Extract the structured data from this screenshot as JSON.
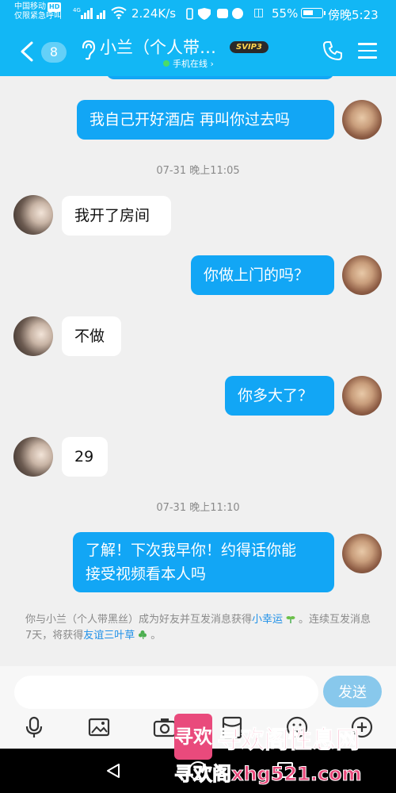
{
  "status_bar": {
    "carrier_line1": "中国移动",
    "carrier_badge": "HD",
    "carrier_line2": "仅限紧急呼叫",
    "net_speed": "2.24K/s",
    "battery_percent": "55%",
    "battery_level": 0.55,
    "time": "傍晚5:23"
  },
  "header": {
    "unread_count": "8",
    "contact_name": "小兰（个人带…",
    "vip_badge": "SVIP3",
    "online_status": "手机在线 ›"
  },
  "messages": [
    {
      "side": "out",
      "text": "我自己开好酒店  再叫你过去吗"
    },
    {
      "side": "time",
      "text": "07-31 晚上11:05"
    },
    {
      "side": "in",
      "text": "我开了房间"
    },
    {
      "side": "out",
      "text": "你做上门的吗？"
    },
    {
      "side": "in",
      "text": "不做"
    },
    {
      "side": "out",
      "text": "你多大了？"
    },
    {
      "side": "in",
      "text": "29"
    },
    {
      "side": "time",
      "text": "07-31 晚上11:10"
    },
    {
      "side": "out",
      "text_line1": "了解！下次我早你！约得话你能",
      "text_line2": "接受视频看本人吗"
    }
  ],
  "notice": {
    "part1": "你与小兰（个人带黑丝）成为好友并互发消息获得",
    "link1": "小幸运",
    "part2": "。连续互发消息7天，将获得",
    "link2": "友谊三叶草",
    "part3": "。"
  },
  "input": {
    "placeholder": "",
    "send_label": "发送"
  },
  "watermark": {
    "logo_text": "寻欢",
    "title": "寻欢阁性息网",
    "url": "寻欢阁xhg521.com"
  },
  "colors": {
    "accent": "#12b7f5",
    "bubble_out": "#12a6f5",
    "watermark": "#e94a7c"
  }
}
